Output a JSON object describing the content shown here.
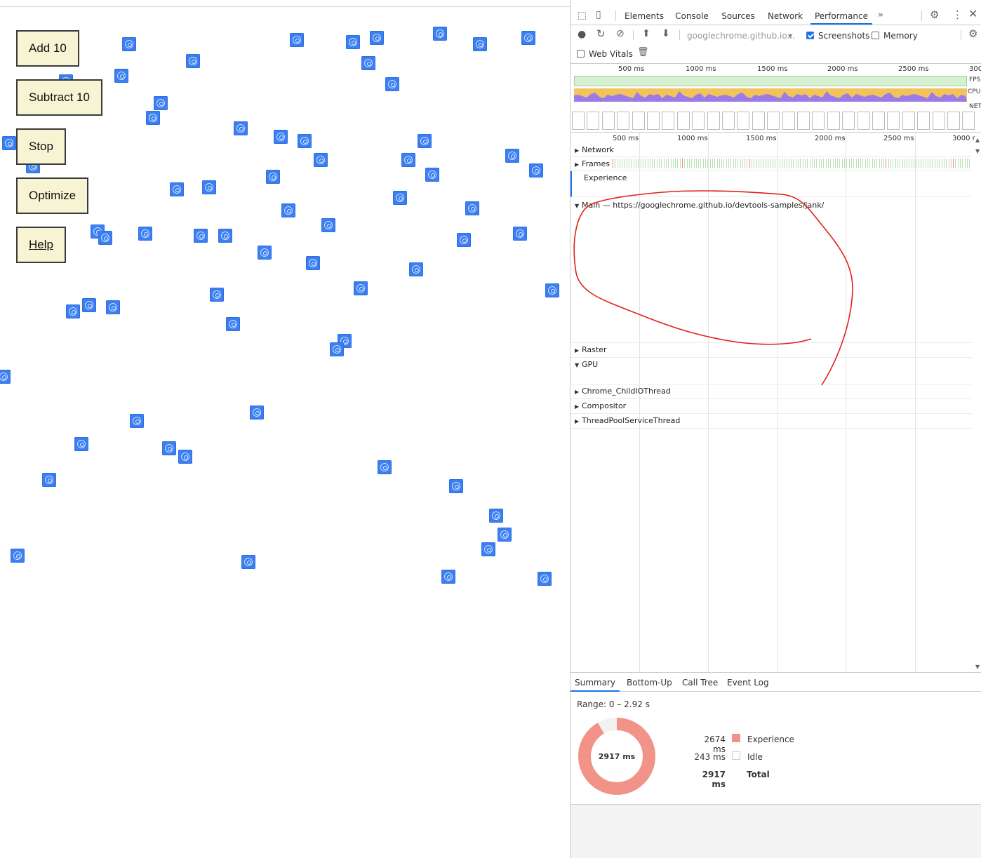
{
  "page": {
    "buttons": {
      "add": "Add 10",
      "subtract": "Subtract 10",
      "stop": "Stop",
      "optimize": "Optimize",
      "help": "Help"
    },
    "proto_icon": "chrome-logo-icon",
    "proto_color": "#3b7ff2"
  },
  "devtools": {
    "tabs": [
      "Elements",
      "Console",
      "Sources",
      "Network",
      "Performance"
    ],
    "active_tab": "Performance",
    "more_tabs_icon": "chevron-double-right-icon",
    "toolbar": {
      "url": "googlechrome.github.io...",
      "screenshots_label": "Screenshots",
      "screenshots_checked": true,
      "memory_label": "Memory",
      "memory_checked": false,
      "web_vitals_label": "Web Vitals",
      "web_vitals_checked": false
    },
    "overview": {
      "ticks": [
        "500 ms",
        "1000 ms",
        "1500 ms",
        "2000 ms",
        "2500 ms",
        "300"
      ],
      "fps_label": "FPS",
      "cpu_label": "CPU",
      "net_label": "NET",
      "fps_color": "#d7f0d2",
      "cpu_color": "#f2c35c",
      "cpu_purple": "#9a7be8"
    },
    "flame": {
      "ticks": [
        "500 ms",
        "1000 ms",
        "1500 ms",
        "2000 ms",
        "2500 ms",
        "3000 r"
      ],
      "tracks": {
        "network": "Network",
        "frames": "Frames",
        "experience": "Experience",
        "main": "Main — https://googlechrome.github.io/devtools-samples/jank/",
        "raster": "Raster",
        "gpu": "GPU",
        "child_io": "Chrome_ChildIOThread",
        "compositor": "Compositor",
        "threadpool": "ThreadPoolServiceThread"
      },
      "annotation_color": "#e0201a"
    },
    "bottom_tabs": [
      "Summary",
      "Bottom-Up",
      "Call Tree",
      "Event Log"
    ],
    "active_bottom_tab": "Summary",
    "summary": {
      "range": "Range: 0 – 2.92 s",
      "total_center": "2917 ms",
      "rows": [
        {
          "value": "2674 ms",
          "label": "Experience",
          "color": "#f2938a"
        },
        {
          "value": "243 ms",
          "label": "Idle",
          "color": "#ffffff"
        },
        {
          "value": "2917 ms",
          "label": "Total",
          "color": ""
        }
      ],
      "experience_fraction": 0.9167
    }
  }
}
